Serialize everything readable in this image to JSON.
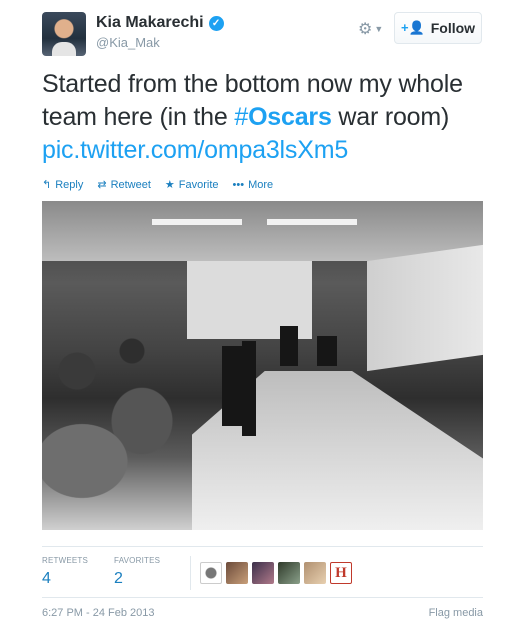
{
  "user": {
    "name": "Kia Makarechi",
    "handle": "@Kia_Mak",
    "verified_icon": "verified-checkmark-icon"
  },
  "header": {
    "gear_icon": "gear-icon",
    "follow_label": "Follow",
    "follow_icon": "add-user-icon"
  },
  "tweet": {
    "text_1": "Started from the bottom now my whole team here (in the ",
    "hashtag_symbol": "#",
    "hashtag_word": "Oscars",
    "text_2": " war room) ",
    "link": "pic.twitter.com/ompa3lsXm5"
  },
  "actions": {
    "reply": "Reply",
    "retweet": "Retweet",
    "favorite": "Favorite",
    "more": "More"
  },
  "stats": {
    "retweets_label": "RETWEETS",
    "retweets_value": "4",
    "favorites_label": "FAVORITES",
    "favorites_value": "2",
    "favoriter_h_letter": "H"
  },
  "footer": {
    "timestamp": "6:27 PM - 24 Feb 2013",
    "flag": "Flag media"
  },
  "colors": {
    "link": "#1da1f2",
    "action": "#1a7fbf",
    "muted": "#8899a6",
    "text": "#292f33"
  }
}
